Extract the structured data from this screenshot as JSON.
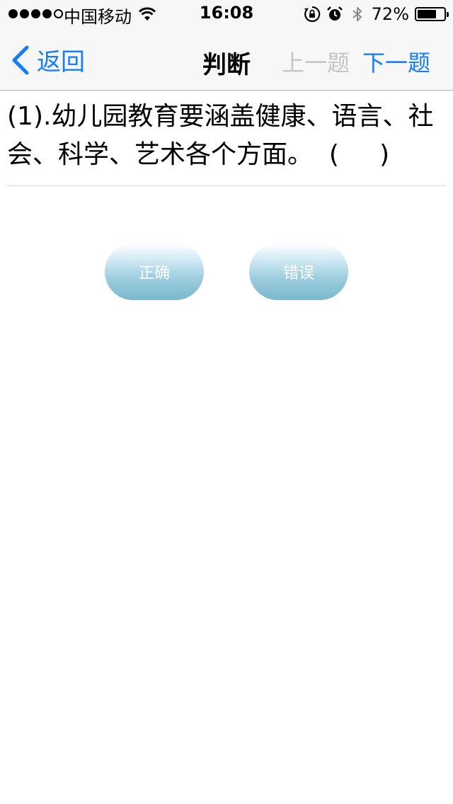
{
  "status_bar": {
    "carrier": "中国移动",
    "time": "16:08",
    "battery_percent": "72%",
    "battery_level": 0.72,
    "signal_bars_filled": 4,
    "signal_bars_total": 5,
    "icons": [
      "wifi-icon",
      "orientation-lock-icon",
      "alarm-icon",
      "bluetooth-icon",
      "battery-icon"
    ]
  },
  "nav": {
    "back_label": "返回",
    "title": "判断",
    "prev_label": "上一题",
    "next_label": "下一题"
  },
  "question": {
    "text": "(1).幼儿园教育要涵盖健康、语言、社会、科学、艺术各个方面。  (     )"
  },
  "answers": {
    "correct_label": "正确",
    "wrong_label": "错误"
  },
  "colors": {
    "accent": "#147efb",
    "disabled": "#c5c5c5",
    "button_gradient_end": "#7bb7cd"
  }
}
